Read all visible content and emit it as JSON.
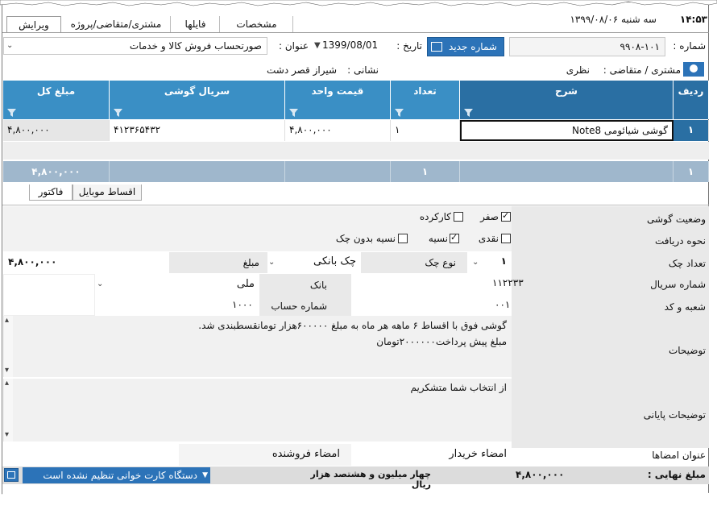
{
  "titlebar": {
    "time": "۱۴:۵۳",
    "day_date": "سه شنبه  ۱۳۹۹/۰۸/۰۶"
  },
  "tabs": [
    {
      "label": "ویرایش"
    },
    {
      "label": "مشتری/متقاضی/پروژه"
    },
    {
      "label": "فایلها"
    },
    {
      "label": "مشخصات"
    }
  ],
  "header": {
    "number_label": "شماره :",
    "number_value": "۹۹۰۸-۱۰۱",
    "new_number_button": "شماره جدید",
    "date_label": "تاریخ :",
    "date_value": "1399/08/01",
    "title_label": "عنوان :",
    "title_value": "صورتحساب فروش کالا و خدمات",
    "customer_label": "مشتری / متقاضی :",
    "customer_value": "نظری",
    "address_label": "نشانی :",
    "address_value": "شیراز قصر دشت"
  },
  "grid": {
    "columns": [
      "ردیف",
      "شرح",
      "تعداد",
      "قیمت واحد",
      "سریال گوشی",
      "مبلغ کل"
    ],
    "rows": [
      {
        "index": "۱",
        "description": "گوشی شیائومی Note8",
        "qty": "۱",
        "unit_price": "۴,۸۰۰,۰۰۰",
        "serial": "۴۱۲۳۶۵۴۳۲",
        "total": "۴,۸۰۰,۰۰۰"
      }
    ],
    "summary": {
      "index": "۱",
      "qty": "۱",
      "total": "۴,۸۰۰,۰۰۰"
    }
  },
  "subtabs": [
    {
      "label": "اقساط موبایل"
    },
    {
      "label": "فاکتور"
    }
  ],
  "form": {
    "phone_status_label": "وضعیت گوشی",
    "status_new": "صفر",
    "status_used": "کارکرده",
    "payment_label": "نحوه دریافت",
    "pay_cash": "نقدی",
    "pay_credit": "نسیه",
    "pay_credit_nocheck": "نسیه بدون چک",
    "check_count_label": "تعداد چک",
    "check_count_value": "۱",
    "check_type_label": "نوع چک",
    "check_type_value": "چک بانکی",
    "amount_label": "مبلغ",
    "amount_value": "۴,۸۰۰,۰۰۰",
    "serial_label": "شماره سریال",
    "serial_value": "۱۱۲۲۳۳",
    "bank_label": "بانک",
    "bank_value": "ملی",
    "branch_label": "شعبه و کد",
    "branch_value": "۰۰۱",
    "account_label": "شماره حساب",
    "account_value": "۱۰۰۰",
    "notes_label": "توضیحات",
    "notes_line1": "گوشی فوق با اقساط ۶ ماهه هر ماه به مبلغ ۶۰۰۰۰۰هزار تومانقسطبندی شد.",
    "notes_line2": "مبلغ پیش پرداخت۲۰۰۰۰۰۰تومان",
    "final_notes_label": "توضیحات پایانی",
    "final_notes_value": "از انتخاب شما متشکریم",
    "signatures_label": "عنوان امضاها",
    "buyer_sign": "امضاء خریدار",
    "seller_sign": "امضاء فروشنده"
  },
  "footer": {
    "final_amount_label": "مبلغ نهایی :",
    "final_amount_value": "۴,۸۰۰,۰۰۰",
    "amount_words": "چهار میلیون و هشتصد  هزار  ریال",
    "card_reader_status": "دستگاه کارت خوانی تنظیم نشده است"
  },
  "colors": {
    "header_blue": "#3a8fc5",
    "selected_blue": "#2a6fa3",
    "summary_gray_blue": "#9fb7cc",
    "button_blue": "#2c73b8"
  }
}
